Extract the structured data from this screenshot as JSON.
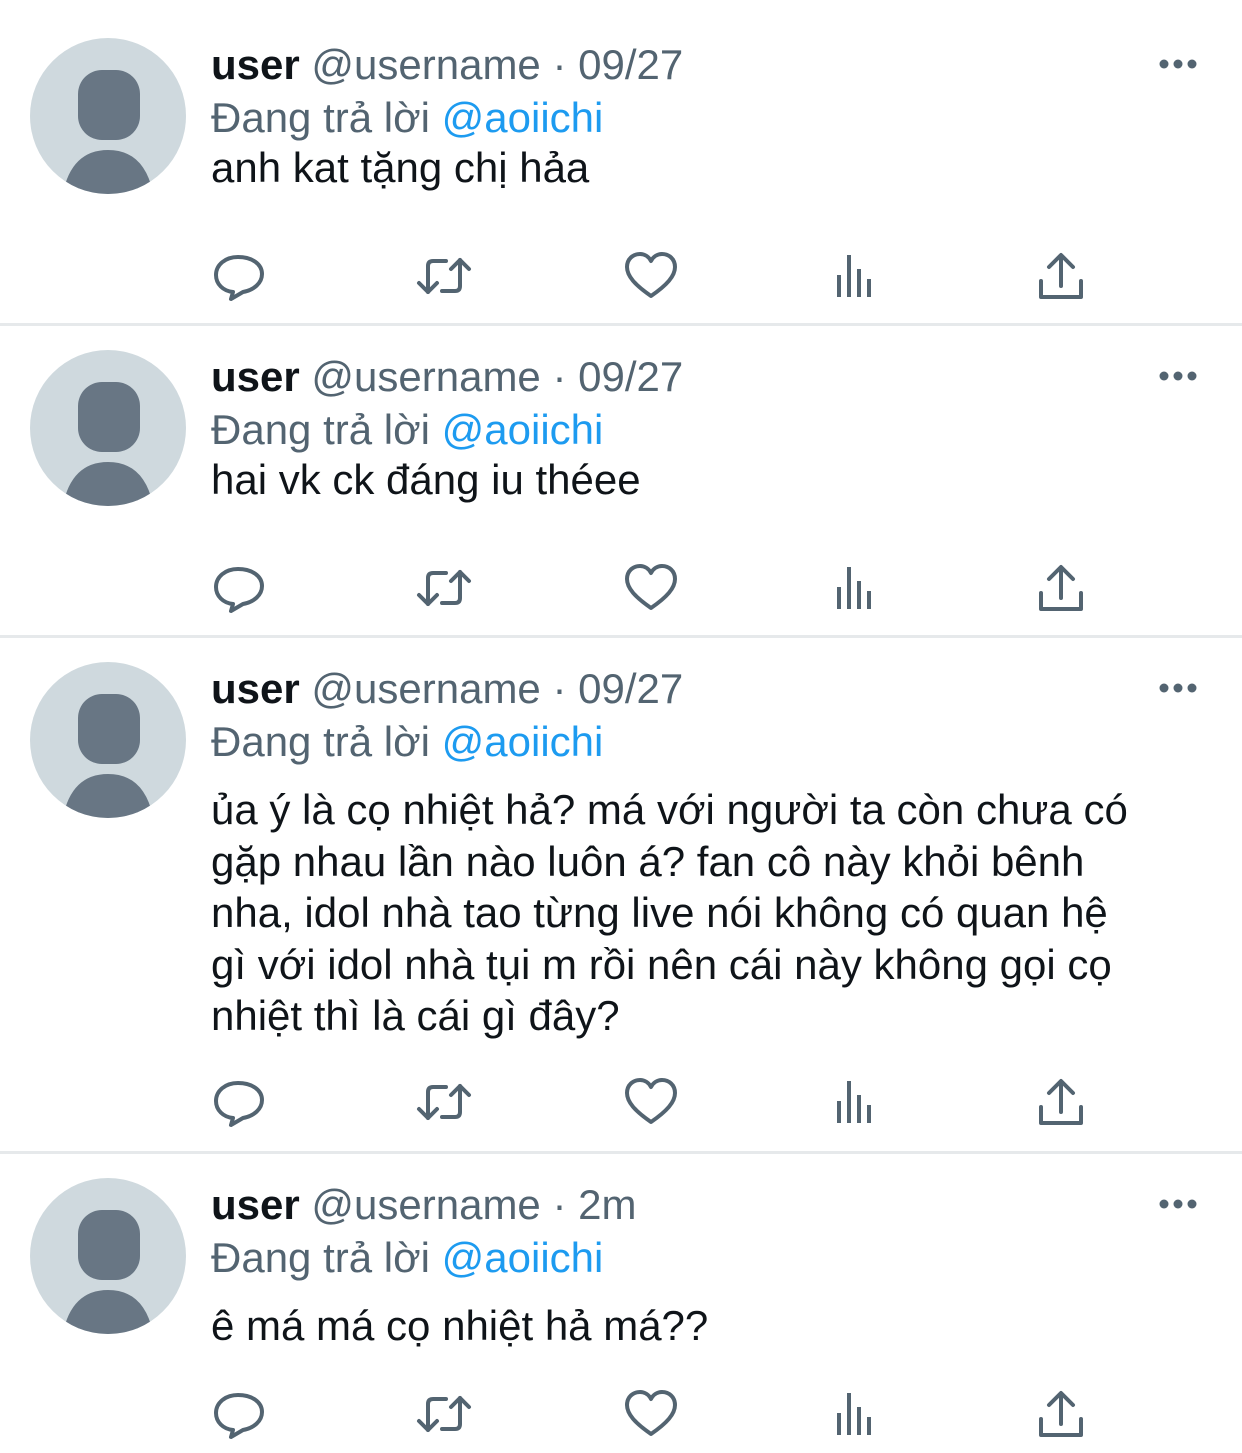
{
  "tweets": [
    {
      "name": "user",
      "handle": "@username",
      "dot": "·",
      "time": "09/27",
      "replying_prefix": "Đang trả lời",
      "replying_to": "@aoiichi",
      "text": "anh kat tặng chị hảa"
    },
    {
      "name": "user",
      "handle": "@username",
      "dot": "·",
      "time": "09/27",
      "replying_prefix": "Đang trả lời",
      "replying_to": "@aoiichi",
      "text": "hai vk ck đáng iu théee"
    },
    {
      "name": "user",
      "handle": "@username",
      "dot": "·",
      "time": "09/27",
      "replying_prefix": "Đang trả lời",
      "replying_to": "@aoiichi",
      "text_lines": [
        "ủa ý là cọ nhiệt hả? má với người ta còn chưa có",
        "gặp nhau lần nào luôn á? fan cô này khỏi bênh",
        "nha, idol nhà tao từng live nói không có quan hệ",
        "gì với idol nhà tụi m rồi nên cái này không gọi cọ",
        "nhiệt thì là cái gì đây?"
      ]
    },
    {
      "name": "user",
      "handle": "@username",
      "dot": "·",
      "time": "2m",
      "replying_prefix": "Đang trả lời",
      "replying_to": "@aoiichi",
      "text": "ê má má cọ nhiệt hả má??"
    }
  ],
  "icons": {
    "more": "more-horizontal-icon",
    "reply": "reply-icon",
    "retweet": "retweet-icon",
    "like": "heart-icon",
    "views": "views-bar-chart-icon",
    "share": "share-icon"
  },
  "colors": {
    "text": "#0f1419",
    "secondary": "#536471",
    "mention": "#1d9bf0",
    "avatar_bg": "#cfd9de",
    "avatar_fg": "#687684",
    "divider": "#e6e9eb"
  }
}
